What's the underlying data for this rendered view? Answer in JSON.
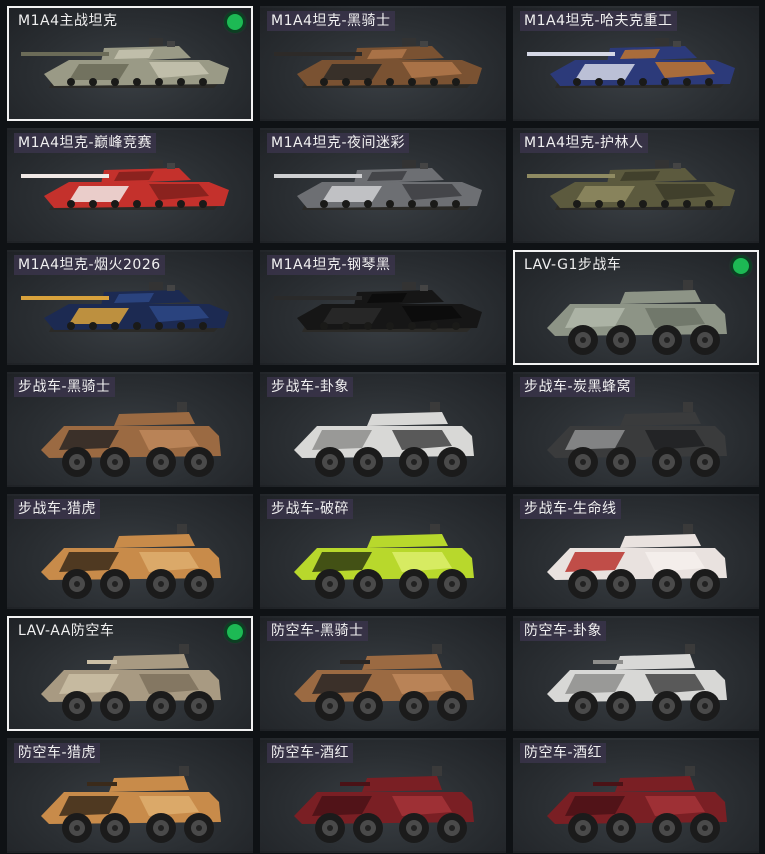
{
  "title": "",
  "colors": {
    "status_active": "#1db954",
    "selected_border": "#f2f2f2",
    "label_bg": "#3a344a"
  },
  "items": [
    {
      "label": "M1A4主战坦克",
      "type": "tank",
      "selected": true,
      "status_icon": "active-dot-icon",
      "camo": [
        "#9a9a86",
        "#6b6b58",
        "#c9c7b3"
      ]
    },
    {
      "label": "M1A4坦克-黑骑士",
      "type": "tank",
      "selected": false,
      "camo": [
        "#7a5232",
        "#2d2a28",
        "#b57a4c"
      ]
    },
    {
      "label": "M1A4坦克-哈夫克重工",
      "type": "tank",
      "selected": false,
      "camo": [
        "#2c3a7a",
        "#d5d8e6",
        "#c9792c"
      ]
    },
    {
      "label": "M1A4坦克-巅峰竞赛",
      "type": "tank",
      "selected": false,
      "camo": [
        "#c4312c",
        "#f1e9e6",
        "#7d1f1c"
      ]
    },
    {
      "label": "M1A4坦克-夜间迷彩",
      "type": "tank",
      "selected": false,
      "camo": [
        "#6d6f73",
        "#cfd0d2",
        "#3a3b3e"
      ]
    },
    {
      "label": "M1A4坦克-护林人",
      "type": "tank",
      "selected": false,
      "camo": [
        "#5c5a3e",
        "#8f8b62",
        "#3b3a28"
      ]
    },
    {
      "label": "M1A4坦克-烟火2026",
      "type": "tank",
      "selected": false,
      "camo": [
        "#1c2a52",
        "#d9a23c",
        "#2e4a8a"
      ]
    },
    {
      "label": "M1A4坦克-钢琴黑",
      "type": "tank",
      "selected": false,
      "camo": [
        "#161616",
        "#2a2a2a",
        "#0a0a0a"
      ]
    },
    {
      "label": "LAV-G1步战车",
      "type": "ifv",
      "selected": true,
      "status_icon": "active-dot-icon",
      "camo": [
        "#8d9486",
        "#b2b8aa",
        "#6a7064"
      ]
    },
    {
      "label": "步战车-黑骑士",
      "type": "ifv",
      "selected": false,
      "camo": [
        "#9b6a42",
        "#2a2624",
        "#c08a5c"
      ]
    },
    {
      "label": "步战车-卦象",
      "type": "ifv",
      "selected": false,
      "camo": [
        "#d8d8d6",
        "#8e8e8c",
        "#3a3a3a"
      ]
    },
    {
      "label": "步战车-炭黑蜂窝",
      "type": "ifv",
      "selected": false,
      "camo": [
        "#3a3b3c",
        "#8f9190",
        "#1e1f20"
      ]
    },
    {
      "label": "步战车-猎虎",
      "type": "ifv",
      "selected": false,
      "camo": [
        "#c88b4a",
        "#3a2a1a",
        "#e0b070"
      ]
    },
    {
      "label": "步战车-破碎",
      "type": "ifv",
      "selected": false,
      "camo": [
        "#b8d82c",
        "#2e3a12",
        "#dff070"
      ]
    },
    {
      "label": "步战车-生命线",
      "type": "ifv",
      "selected": false,
      "camo": [
        "#e9e2df",
        "#b8322e",
        "#f6f1ee"
      ]
    },
    {
      "label": "LAV-AA防空车",
      "type": "aa",
      "selected": true,
      "status_icon": "active-dot-icon",
      "camo": [
        "#a89a82",
        "#cbbfa6",
        "#7a6e5a"
      ]
    },
    {
      "label": "防空车-黑骑士",
      "type": "aa",
      "selected": false,
      "camo": [
        "#9b6a42",
        "#2a2624",
        "#c08a5c"
      ]
    },
    {
      "label": "防空车-卦象",
      "type": "aa",
      "selected": false,
      "camo": [
        "#d8d8d6",
        "#8e8e8c",
        "#3a3a3a"
      ]
    },
    {
      "label": "防空车-猎虎",
      "type": "aa",
      "selected": false,
      "camo": [
        "#c88b4a",
        "#3a2a1a",
        "#e0b070"
      ]
    },
    {
      "label": "防空车-酒红",
      "type": "aa",
      "selected": false,
      "camo": [
        "#7a1f24",
        "#4a1216",
        "#a8353a"
      ]
    },
    {
      "label": "防空车-酒红",
      "type": "aa",
      "selected": false,
      "camo": [
        "#7a1f24",
        "#4a1216",
        "#a8353a"
      ]
    }
  ]
}
